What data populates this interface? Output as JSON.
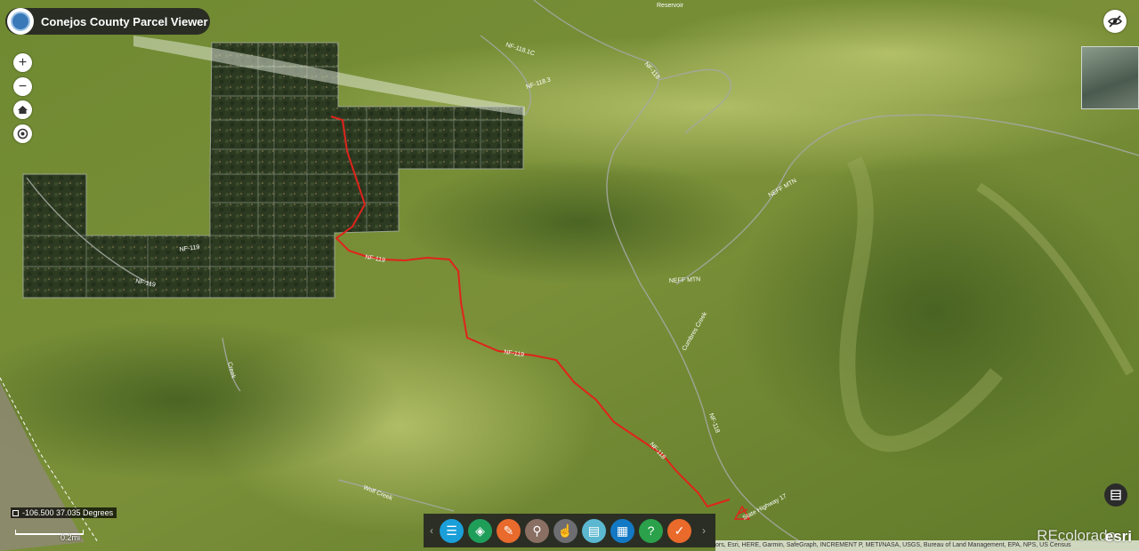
{
  "app": {
    "title": "Conejos County Parcel Viewer"
  },
  "controls": {
    "zoom_in": "+",
    "zoom_out": "−",
    "home_icon": "home-icon",
    "locate_icon": "locate-icon",
    "visibility_icon": "eye-off-icon",
    "legend_icon": "table-icon"
  },
  "status": {
    "coordinates": "-106.500 37.035 Degrees",
    "scale_label": "0.2mi"
  },
  "map_labels": {
    "reservoir": "Reservoir",
    "nf118_1c": "NF-118.1C",
    "nf118_3": "NF-118.3",
    "nf118_a": "NF-118",
    "nf119_a": "NF-119",
    "nf119_b": "NF-119",
    "nf119_c": "NF-119",
    "nf119_route": "NF-119",
    "nf118_route": "NF-118",
    "nf118_east": "NF-118",
    "neff_mtn_a": "NEFF MTN",
    "neff_mtn_b": "NEFF MTN",
    "state_hwy": "State Highway 17",
    "creek_a": "Wolf Creek",
    "creek_b": "Cumbres Creek",
    "creek_c": "Creek"
  },
  "toolbar": {
    "prev": "‹",
    "next": "›",
    "buttons": [
      {
        "icon": "list-icon",
        "glyph": "☰",
        "color": "#1a9fd9"
      },
      {
        "icon": "layers-icon",
        "glyph": "◈",
        "color": "#1f9e5a"
      },
      {
        "icon": "draw-icon",
        "glyph": "✎",
        "color": "#e86a2c"
      },
      {
        "icon": "search-icon",
        "glyph": "⚲",
        "color": "#8a6f63"
      },
      {
        "icon": "select-icon",
        "glyph": "☝",
        "color": "#6d6d72"
      },
      {
        "icon": "print-icon",
        "glyph": "▤",
        "color": "#5cb8d0"
      },
      {
        "icon": "grid-icon",
        "glyph": "▦",
        "color": "#1479c4"
      },
      {
        "icon": "info-icon",
        "glyph": "?",
        "color": "#2aa14a"
      },
      {
        "icon": "check-icon",
        "glyph": "✓",
        "color": "#ea6a2b"
      }
    ]
  },
  "attribution": "ors, Esri, HERE, Garmin, SafeGraph, INCREMENT P, METI/NASA, USGS, Bureau of Land Management, EPA, NPS, US Census",
  "branding": {
    "esri": "esri",
    "watermark": "REcolorado"
  },
  "colors": {
    "route": "#e0231c",
    "parcel": "#27331f"
  }
}
